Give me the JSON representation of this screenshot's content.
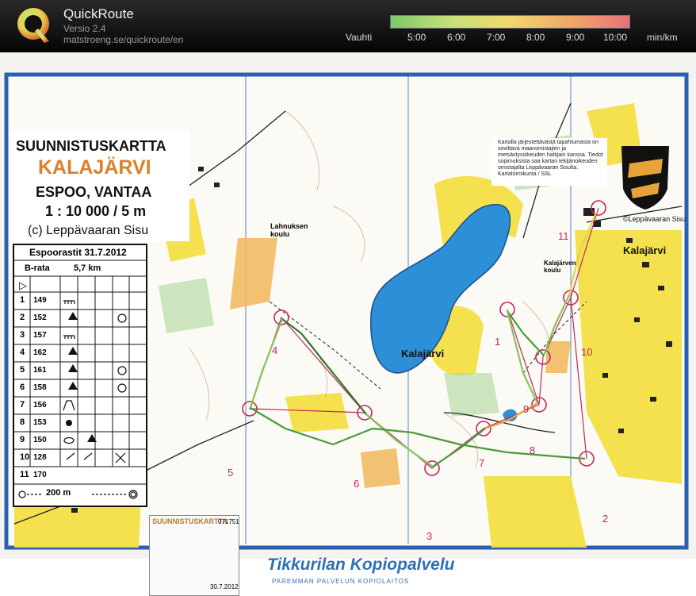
{
  "app": {
    "title": "QuickRoute",
    "version": "Versio 2.4",
    "url": "matstroeng.se/quickroute/en",
    "logo_icon": "q-logo-icon"
  },
  "pace_legend": {
    "label": "Vauhti",
    "ticks": [
      "5:00",
      "6:00",
      "7:00",
      "8:00",
      "9:00",
      "10:00"
    ],
    "unit": "min/km",
    "colors": [
      "#7ec86a",
      "#c6e07a",
      "#f0d86e",
      "#f0a866",
      "#e8727a"
    ]
  },
  "map": {
    "title_lines": [
      "SUUNNISTUSKARTTA",
      "KALAJÄRVI",
      "ESPOO, VANTAA",
      "1 : 10 000 / 5 m"
    ],
    "copyright": "(c) Leppävaaran Sisu",
    "club": "©Leppävaaran Sisu",
    "notice": "Kartalla järjestettävästä tapahtumasta on sovittava maanomistajien ja metsästysoikeuden haltijain kanssa. Tiedot sopimuksista saa kartan tekijänoikeuden omistajalta Leppävaaran Sisulta. Kartatoimikunta / SSL",
    "place_names": {
      "kalajarvi": "Kalajärvi",
      "lake": "Kalajärvi",
      "school_1": "Lahnuksen koulu",
      "school_2": "Kalajärven koulu"
    },
    "stamp": {
      "title": "SUUNNISTUSKARTTA",
      "number": "071751",
      "date": "30.7.2012"
    },
    "printer": {
      "name": "Tikkurilan Kopiopalvelu",
      "slogan": "PAREMMAN PALVELUN KOPIOLAITOS"
    },
    "course_controls": [
      "1",
      "2",
      "3",
      "4",
      "5",
      "6",
      "7",
      "8",
      "9",
      "10",
      "11"
    ]
  },
  "control_card": {
    "title": "Espoorastit 31.7.2012",
    "course": "B-rata",
    "length": "5,7 km",
    "footer": "200 m",
    "rows": [
      {
        "num": "1",
        "code": "149"
      },
      {
        "num": "2",
        "code": "152"
      },
      {
        "num": "3",
        "code": "157"
      },
      {
        "num": "4",
        "code": "162"
      },
      {
        "num": "5",
        "code": "161"
      },
      {
        "num": "6",
        "code": "158"
      },
      {
        "num": "7",
        "code": "156"
      },
      {
        "num": "8",
        "code": "153"
      },
      {
        "num": "9",
        "code": "150"
      },
      {
        "num": "10",
        "code": "128"
      },
      {
        "num": "11",
        "code": "170"
      }
    ]
  }
}
